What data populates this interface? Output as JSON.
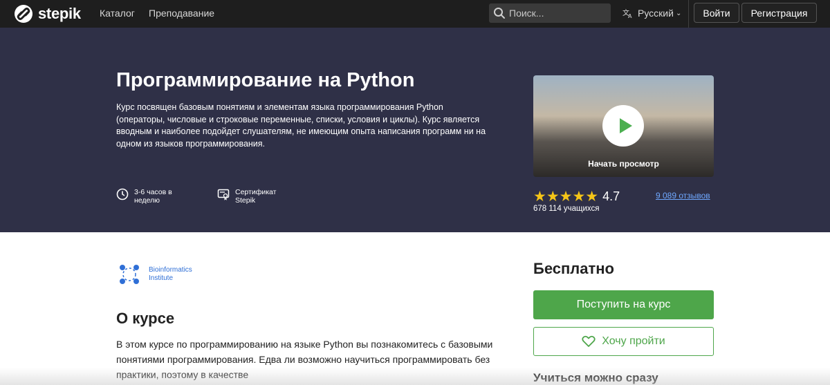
{
  "topbar": {
    "logo_text": "stepik",
    "nav": [
      {
        "label": "Каталог"
      },
      {
        "label": "Преподавание"
      }
    ],
    "search_placeholder": "Поиск...",
    "language": "Русский",
    "login_label": "Войти",
    "register_label": "Регистрация"
  },
  "hero": {
    "title": "Программирование на Python",
    "description": "Курс посвящен базовым понятиям и элементам языка программирования Python (операторы, числовые и строковые переменные, списки, условия и циклы). Курс является вводным и наиболее подойдет слушателям, не имеющим опыта написания программ ни на одном из языков программирования.",
    "meta": [
      {
        "icon": "clock-icon",
        "text": "3-6 часов в неделю"
      },
      {
        "icon": "certificate-icon",
        "text": "Сертификат Stepik"
      }
    ],
    "video_label": "Начать просмотр",
    "rating": "4.7",
    "stars": "★★★★★",
    "reviews": "9 089 отзывов",
    "learners": "678 114 учащихся"
  },
  "main": {
    "author": "Bioinformatics Institute",
    "about_title": "О курсе",
    "about_text": "В этом курсе по программированию на языке Python вы познакомитесь с базовыми понятиями программирования. Едва ли возможно научиться программировать без практики, поэтому в качестве"
  },
  "sidebar": {
    "price": "Бесплатно",
    "enroll_label": "Поступить на курс",
    "wishlist_label": "Хочу пройти",
    "learn_now": "Учиться можно сразу"
  },
  "colors": {
    "topbar": "#1e1e1e",
    "hero": "#2f3047",
    "accent_green": "#4ea64a",
    "link_blue": "#6fa8ff",
    "star": "#f5c518"
  }
}
